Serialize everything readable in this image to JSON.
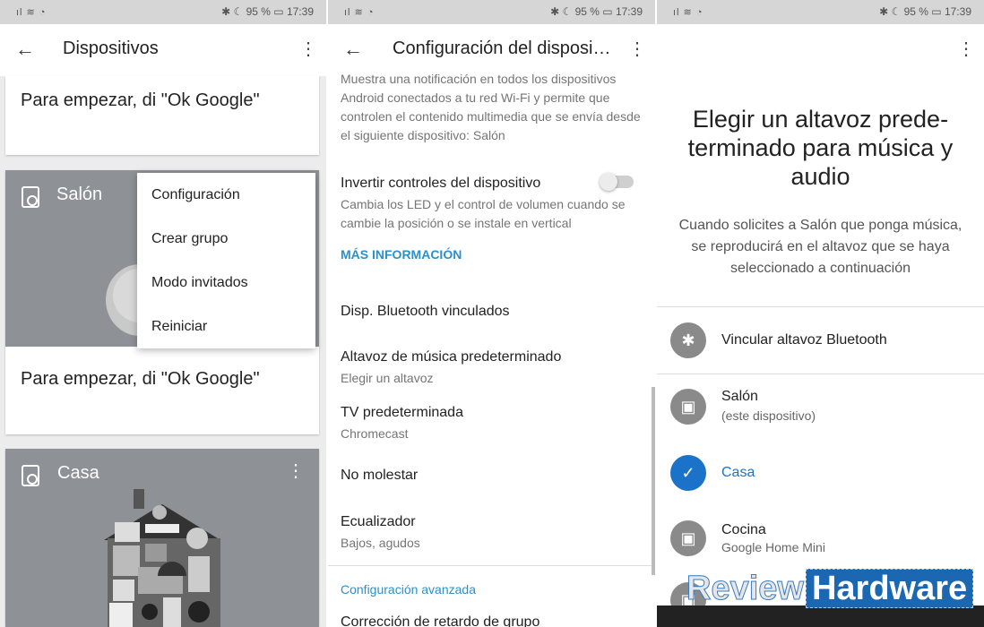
{
  "status": {
    "left": "ıl ≋ ◔",
    "right": "✱ ☾ 95 % ▭ 17:39"
  },
  "panel1": {
    "title": "Dispositivos",
    "card1_text": "Para empezar, di \"Ok Google\"",
    "device1": "Salón",
    "card2_text": "Para empezar, di \"Ok Google\"",
    "device2": "Casa",
    "menu": [
      "Configuración",
      "Crear grupo",
      "Modo invitados",
      "Reiniciar"
    ]
  },
  "panel2": {
    "title": "Configuración del disposi…",
    "top_text": "Muestra una notificación en todos los dispositivos Android conectados a tu red Wi-Fi y permite que controlen el contenido multimedia que se envía desde el siguiente dispositivo: Salón",
    "invert_title": "Invertir controles del dispositivo",
    "invert_sub": "Cambia los LED y el control de volumen cuando se cambie la posición o se instale en vertical",
    "more_info": "MÁS INFORMACIÓN",
    "bluetooth": "Disp. Bluetooth vinculados",
    "speaker_title": "Altavoz de música predeterminado",
    "speaker_sub": "Elegir un altavoz",
    "tv_title": "TV predeterminada",
    "tv_sub": "Chromecast",
    "dnd": "No molestar",
    "eq_title": "Ecualizador",
    "eq_sub": "Bajos, agudos",
    "advanced": "Configuración avanzada",
    "delay": "Corrección de retardo de grupo"
  },
  "panel3": {
    "heading": "Elegir un altavoz prede-terminado para música y audio",
    "description": "Cuando solicites a Salón que ponga música, se reproducirá en el altavoz que se haya seleccionado a continuación",
    "bt": "Vincular altavoz Bluetooth",
    "salon": "Salón",
    "salon_sub": "(este dispositivo)",
    "casa": "Casa",
    "cocina": "Cocina",
    "cocina_sub": "Google Home Mini"
  },
  "watermark": {
    "a": "Review",
    "b": "Hardware"
  }
}
